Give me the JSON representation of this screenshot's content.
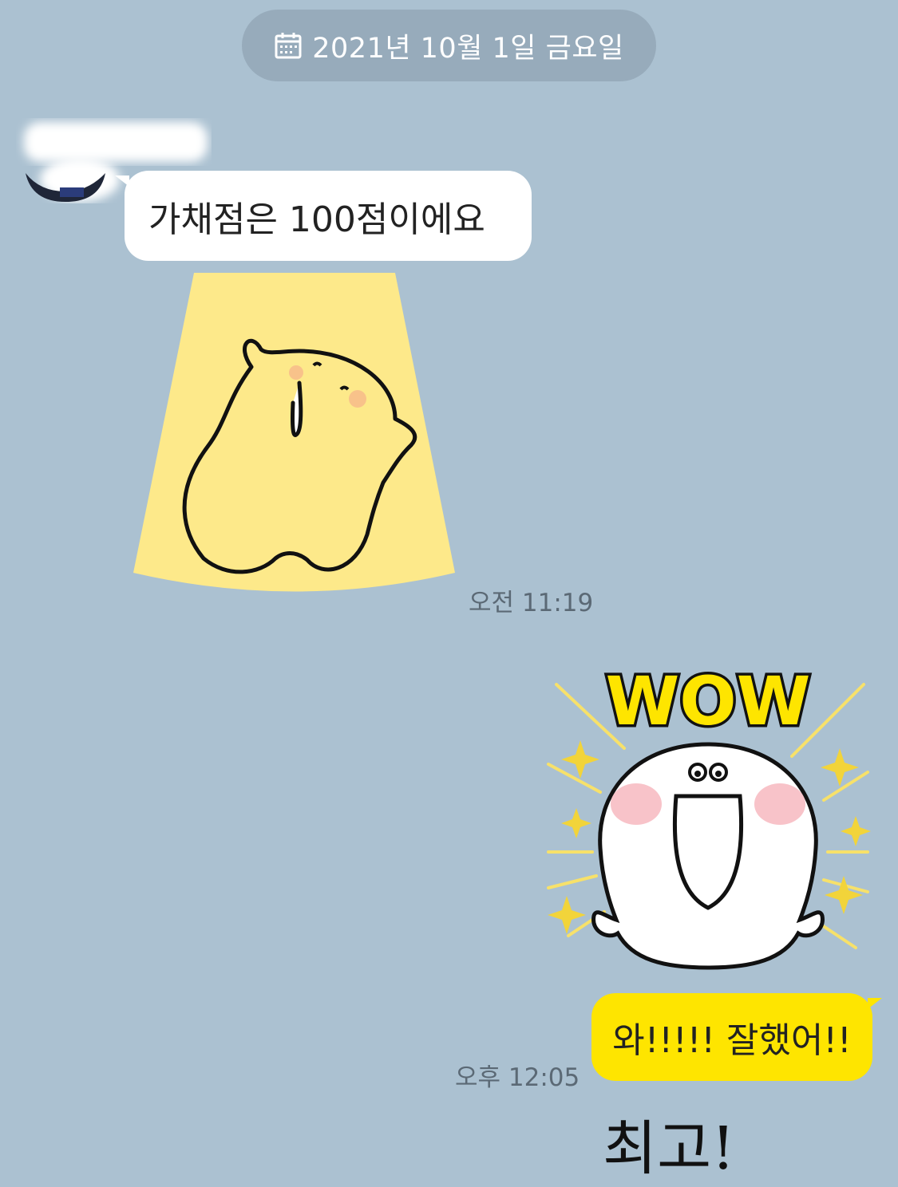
{
  "date_divider": {
    "label": "2021년 10월 1일 금요일",
    "icon": "calendar-icon"
  },
  "messages": [
    {
      "direction": "incoming",
      "type": "text",
      "text": "가채점은 100점이에요"
    },
    {
      "direction": "incoming",
      "type": "sticker",
      "sticker": "yellow-bear-cheering",
      "time": "오전 11:19"
    },
    {
      "direction": "outgoing",
      "type": "sticker",
      "sticker": "wow-ghost",
      "sticker_text": "WOW"
    },
    {
      "direction": "outgoing",
      "type": "text",
      "text": "와!!!!! 잘했어!!",
      "time": "오후 12:05"
    }
  ],
  "cropped_bottom_text": "최고!",
  "colors": {
    "background": "#abc1d1",
    "date_pill": "#97abbb",
    "incoming_bubble": "#ffffff",
    "outgoing_bubble": "#fee500",
    "timestamp": "#5b6975"
  }
}
